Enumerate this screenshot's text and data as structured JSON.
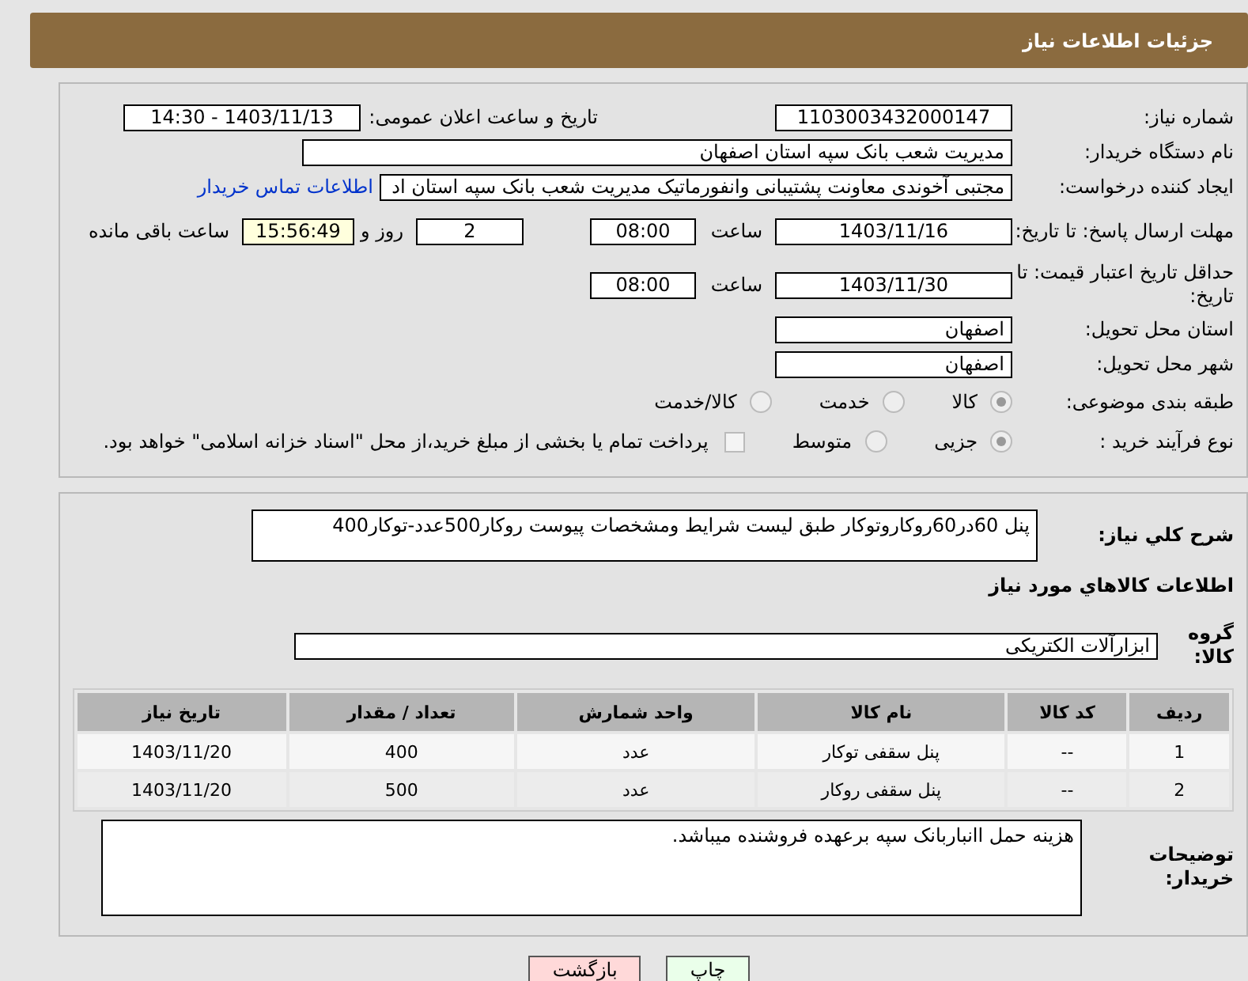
{
  "header": {
    "title": "جزئیات اطلاعات نیاز"
  },
  "fields": {
    "need_number": {
      "label": "شماره نیاز:",
      "value": "1103003432000147"
    },
    "announce": {
      "label": "تاریخ و ساعت اعلان عمومی:",
      "value": "1403/11/13 - 14:30"
    },
    "buyer": {
      "label": "نام دستگاه خریدار:",
      "value": "مدیریت شعب بانک سپه استان اصفهان"
    },
    "creator": {
      "label": "ایجاد کننده درخواست:",
      "value": "مجتبی آخوندی معاونت پشتیبانی وانفورماتیک مدیریت شعب بانک سپه استان اد",
      "link": "اطلاعات تماس خریدار"
    },
    "deadline": {
      "label": "مهلت ارسال پاسخ: تا تاریخ:",
      "date": "1403/11/16",
      "time_label": "ساعت",
      "time": "08:00",
      "days": "2",
      "days_label": "روز و",
      "remaining": "15:56:49",
      "remaining_label": "ساعت باقی مانده"
    },
    "validity": {
      "label": "حداقل تاریخ اعتبار قیمت: تا تاریخ:",
      "date": "1403/11/30",
      "time_label": "ساعت",
      "time": "08:00"
    },
    "province": {
      "label": "استان محل تحویل:",
      "value": "اصفهان"
    },
    "city": {
      "label": "شهر محل تحویل:",
      "value": "اصفهان"
    },
    "category": {
      "label": "طبقه بندی موضوعی:",
      "options": [
        {
          "label": "کالا",
          "selected": true
        },
        {
          "label": "خدمت",
          "selected": false
        },
        {
          "label": "کالا/خدمت",
          "selected": false
        }
      ]
    },
    "process": {
      "label": "نوع فرآیند خرید :",
      "options": [
        {
          "label": "جزیی",
          "selected": true
        },
        {
          "label": "متوسط",
          "selected": false
        }
      ],
      "payment": {
        "label": "پرداخت تمام یا بخشی از مبلغ خرید،از محل \"اسناد خزانه اسلامی\" خواهد بود.",
        "checked": false
      }
    }
  },
  "description": {
    "label": "شرح كلي نياز:",
    "value": "پنل 60در60روکاروتوکار طبق لیست شرایط ومشخصات پیوست روکار500عدد-توکار400"
  },
  "goods_title": "اطلاعات كالاهاي مورد نياز",
  "group": {
    "label": "گروه كالا:",
    "value": "ابزارآلات الکتریکی"
  },
  "table": {
    "columns": [
      "ردیف",
      "کد کالا",
      "نام کالا",
      "واحد شمارش",
      "تعداد / مقدار",
      "تاریخ نیاز"
    ],
    "rows": [
      [
        "1",
        "--",
        "پنل سقفی توکار",
        "عدد",
        "400",
        "1403/11/20"
      ],
      [
        "2",
        "--",
        "پنل سقفی روکار",
        "عدد",
        "500",
        "1403/11/20"
      ]
    ]
  },
  "notes": {
    "label": "توضیحات خریدار:",
    "value": "هزینه حمل اانباربانک سپه برعهده فروشنده میباشد."
  },
  "buttons": [
    {
      "label": "چاپ",
      "kind": "print"
    },
    {
      "label": "بازگشت",
      "kind": "back"
    }
  ]
}
